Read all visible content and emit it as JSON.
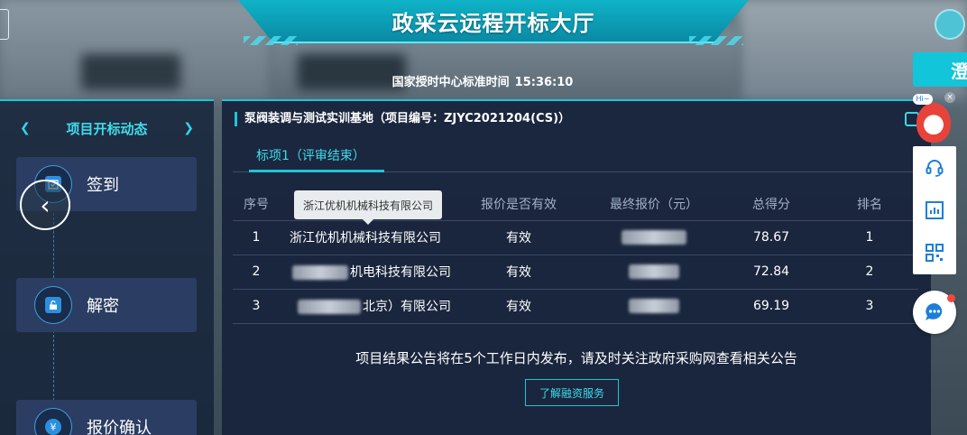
{
  "header": {
    "title": "政采云远程开标大厅",
    "time_label": "国家授时中心标准时间",
    "time_value": "15:36:10"
  },
  "left_panel": {
    "title": "项目开标动态",
    "steps": [
      {
        "label": "签到",
        "icon": "calendar-check-icon"
      },
      {
        "label": "解密",
        "icon": "unlock-icon"
      },
      {
        "label": "报价确认",
        "icon": "currency-icon"
      }
    ]
  },
  "project": {
    "title": "泵阀装调与测试实训基地（项目编号：ZJYC2021204(CS)）",
    "tab_label": "标项1（评审结束）"
  },
  "table": {
    "headers": [
      "序号",
      "",
      "报价是否有效",
      "最终报价（元）",
      "总得分",
      "排名"
    ],
    "rows": [
      {
        "seq": "1",
        "name": "浙江优机机械科技有限公司",
        "valid": "有效",
        "score": "78.67",
        "rank": "1"
      },
      {
        "seq": "2",
        "name": "机电科技有限公司",
        "valid": "有效",
        "score": "72.84",
        "rank": "2"
      },
      {
        "seq": "3",
        "name": "北京）有限公司",
        "valid": "有效",
        "score": "69.19",
        "rank": "3"
      }
    ]
  },
  "tooltip": "浙江优机机械科技有限公司",
  "notice": "项目结果公告将在5个工作日内发布，请及时关注政府采购网查看相关公告",
  "finance_button": "了解融资服务",
  "side": {
    "tab_text": "澄",
    "mascot_bubble": "Hi~"
  },
  "colors": {
    "accent": "#1fc4d8",
    "panel": "#18243c",
    "step_bg": "#2b3d62"
  }
}
